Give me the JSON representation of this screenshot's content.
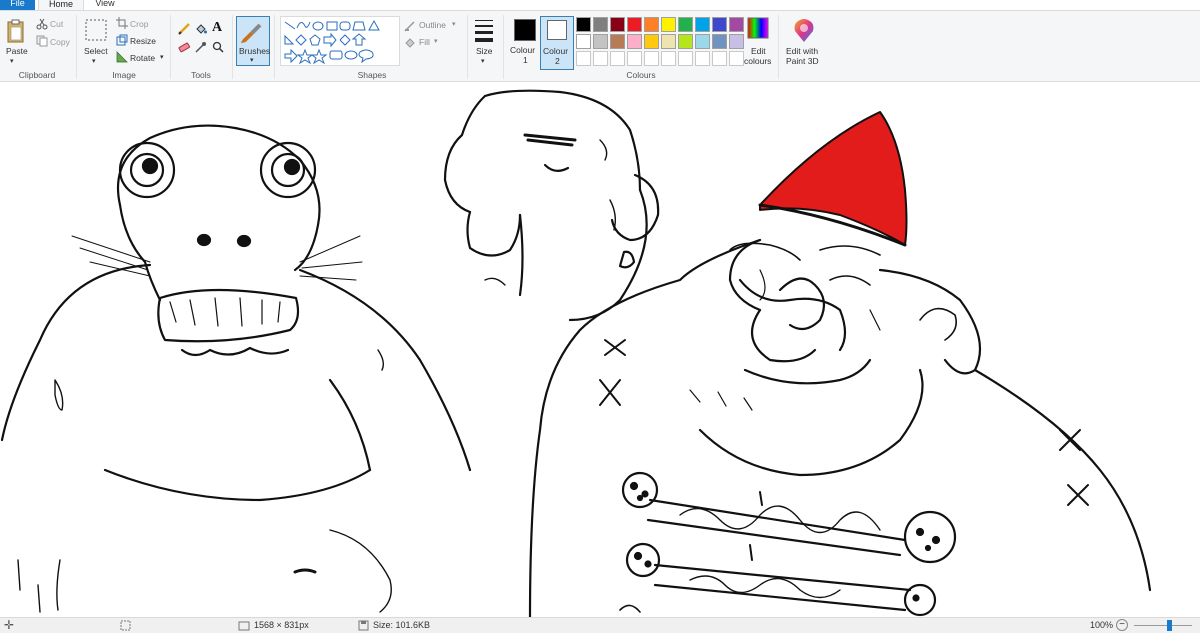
{
  "tabs": {
    "file": "File",
    "home": "Home",
    "view": "View"
  },
  "clipboard": {
    "paste": "Paste",
    "cut": "Cut",
    "copy": "Copy",
    "group": "Clipboard"
  },
  "image": {
    "select": "Select",
    "crop": "Crop",
    "resize": "Resize",
    "rotate": "Rotate",
    "group": "Image"
  },
  "tools": {
    "group": "Tools",
    "text_tool": "A"
  },
  "brushes": {
    "label": "Brushes"
  },
  "shapes": {
    "outline": "Outline",
    "fill": "Fill",
    "group": "Shapes"
  },
  "size": {
    "label": "Size"
  },
  "colours": {
    "colour1_label": "Colour",
    "colour1_num": "1",
    "colour2_label": "Colour",
    "colour2_num": "2",
    "colour1": "#000000",
    "colour2": "#ffffff",
    "edit_label_1": "Edit",
    "edit_label_2": "colours",
    "group": "Colours",
    "palette_row1": [
      "#000000",
      "#7f7f7f",
      "#880015",
      "#ed1c24",
      "#ff7f27",
      "#fff200",
      "#22b14c",
      "#00a2e8",
      "#3f48cc",
      "#a349a4"
    ],
    "palette_row2": [
      "#ffffff",
      "#c3c3c3",
      "#b97a57",
      "#ffaec9",
      "#ffc90e",
      "#efe4b0",
      "#b5e61d",
      "#99d9ea",
      "#7092be",
      "#c8bfe7"
    ]
  },
  "paint3d": {
    "label_1": "Edit with",
    "label_2": "Paint 3D"
  },
  "status": {
    "dimensions": "1568 × 831px",
    "size": "Size: 101.6KB",
    "zoom": "100%",
    "zoom_level": 1.0
  }
}
